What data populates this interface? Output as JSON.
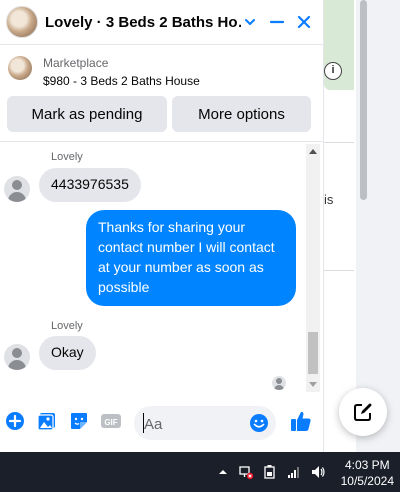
{
  "chat": {
    "header_title": "Lovely · 3 Beds 2 Baths Ho…",
    "product_category": "Marketplace",
    "product_title": "$980 - 3 Beds 2 Baths House",
    "mark_pending_label": "Mark as pending",
    "more_options_label": "More options"
  },
  "messages": [
    {
      "sender": "Lovely",
      "text": "4433976535",
      "direction": "in"
    },
    {
      "text": "Thanks for sharing your contact number I will contact at your number as soon as possible",
      "direction": "out"
    },
    {
      "sender": "Lovely",
      "text": "Okay",
      "direction": "in"
    }
  ],
  "composer": {
    "placeholder": "Aa",
    "value": ""
  },
  "background_page": {
    "partial_text": "is"
  },
  "taskbar": {
    "time": "4:03 PM",
    "date": "10/5/2024"
  },
  "colors": {
    "accent": "#0a7cff",
    "outgoing_bubble": "#0084ff",
    "incoming_bubble": "#e4e6eb",
    "taskbar": "#1b1f2a"
  },
  "icons": [
    "chevron-down-icon",
    "minimize-icon",
    "close-icon",
    "plus-circle-icon",
    "photo-icon",
    "sticker-icon",
    "gif-icon",
    "emoji-icon",
    "thumbs-up-icon",
    "compose-icon",
    "info-icon"
  ]
}
